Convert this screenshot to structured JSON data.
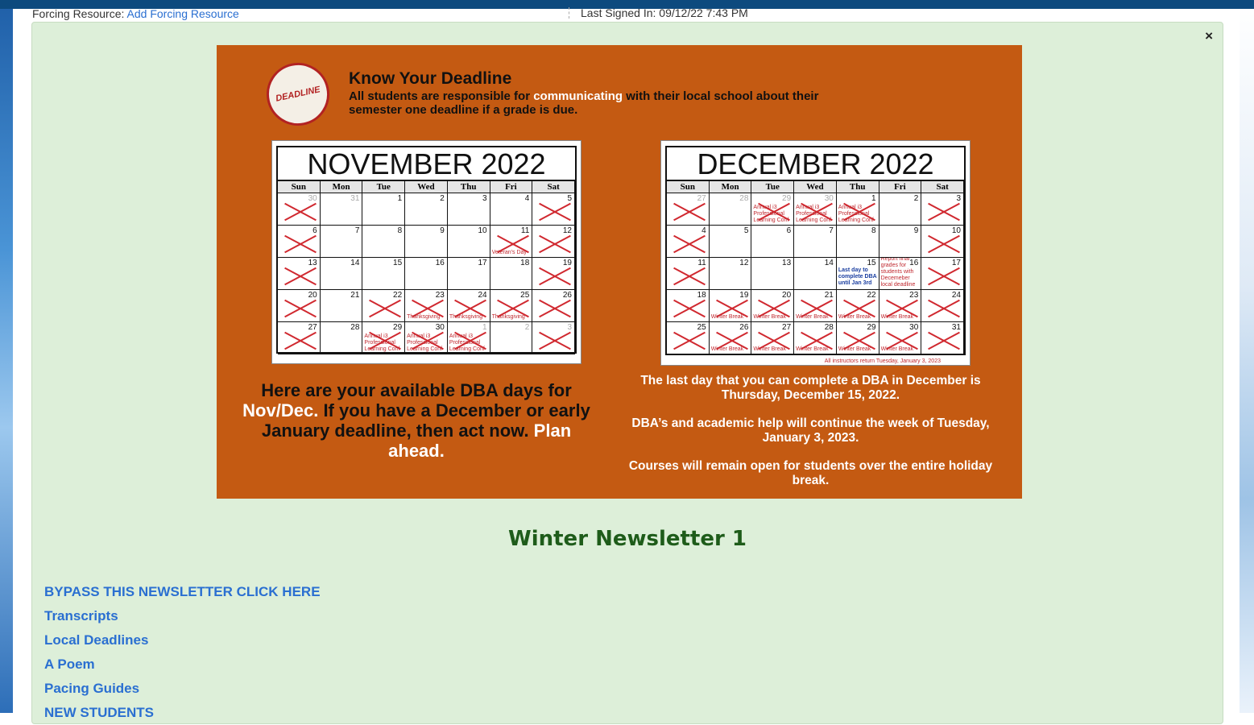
{
  "header": {
    "forcing_label": "Forcing Resource:",
    "forcing_link": "Add Forcing Resource",
    "signed_in": "Last Signed In: 09/12/22 7:43 PM"
  },
  "modal": {
    "close_symbol": "×"
  },
  "banner": {
    "stamp_text": "DEADLINE",
    "title": "Know Your Deadline",
    "subtitle_a": "All students are responsible for ",
    "subtitle_hl": "communicating",
    "subtitle_b": " with their local school about their semester one deadline if a grade is due.",
    "avail_a": "Here are your available DBA days for ",
    "avail_w1": "Nov/Dec.",
    "avail_b": " If you have a December or early January deadline, then act now. ",
    "avail_w2": "Plan ahead.",
    "dec_p1": "The last day that you can complete a DBA in December is Thursday, December 15, 2022.",
    "dec_p2": "DBA’s and academic help will continue the week of Tuesday, January 3, 2023.",
    "dec_p3": "Courses will remain open for students over the entire holiday break."
  },
  "calendars": [
    {
      "title": "NOVEMBER 2022",
      "days": [
        "Sun",
        "Mon",
        "Tue",
        "Wed",
        "Thu",
        "Fri",
        "Sat"
      ],
      "cells": [
        {
          "n": "30",
          "dim": true,
          "x": true
        },
        {
          "n": "31",
          "dim": true
        },
        {
          "n": "1"
        },
        {
          "n": "2"
        },
        {
          "n": "3"
        },
        {
          "n": "4"
        },
        {
          "n": "5",
          "x": true
        },
        {
          "n": "6",
          "x": true
        },
        {
          "n": "7"
        },
        {
          "n": "8"
        },
        {
          "n": "9"
        },
        {
          "n": "10"
        },
        {
          "n": "11",
          "x": true,
          "note": "Veteran's Day"
        },
        {
          "n": "12",
          "x": true
        },
        {
          "n": "13",
          "x": true
        },
        {
          "n": "14"
        },
        {
          "n": "15"
        },
        {
          "n": "16"
        },
        {
          "n": "17"
        },
        {
          "n": "18"
        },
        {
          "n": "19",
          "x": true
        },
        {
          "n": "20",
          "x": true
        },
        {
          "n": "21"
        },
        {
          "n": "22",
          "x": true
        },
        {
          "n": "23",
          "x": true,
          "note": "Thanksgiving"
        },
        {
          "n": "24",
          "x": true,
          "note": "Thanksgiving"
        },
        {
          "n": "25",
          "x": true,
          "note": "Thanksgiving"
        },
        {
          "n": "26",
          "x": true
        },
        {
          "n": "27",
          "x": true
        },
        {
          "n": "28"
        },
        {
          "n": "29",
          "x": true,
          "note": "Annual i3 Professional Learning Conf"
        },
        {
          "n": "30",
          "x": true,
          "note": "Annual i3 Professional Learning Conf"
        },
        {
          "n": "1",
          "dim": true,
          "x": true,
          "note": "Annual i3 Professional Learning Conf"
        },
        {
          "n": "2",
          "dim": true
        },
        {
          "n": "3",
          "dim": true,
          "x": true
        }
      ],
      "footer": ""
    },
    {
      "title": "DECEMBER 2022",
      "days": [
        "Sun",
        "Mon",
        "Tue",
        "Wed",
        "Thu",
        "Fri",
        "Sat"
      ],
      "cells": [
        {
          "n": "27",
          "dim": true,
          "x": true
        },
        {
          "n": "28",
          "dim": true
        },
        {
          "n": "29",
          "dim": true,
          "x": true,
          "note": "Annual i3 Professional Learning Conf"
        },
        {
          "n": "30",
          "dim": true,
          "x": true,
          "note": "Annual i3 Professional Learning Conf"
        },
        {
          "n": "1",
          "x": true,
          "note": "Annual i3 Professional Learning Conf"
        },
        {
          "n": "2"
        },
        {
          "n": "3",
          "x": true
        },
        {
          "n": "4",
          "x": true
        },
        {
          "n": "5"
        },
        {
          "n": "6"
        },
        {
          "n": "7"
        },
        {
          "n": "8"
        },
        {
          "n": "9"
        },
        {
          "n": "10",
          "x": true
        },
        {
          "n": "11",
          "x": true
        },
        {
          "n": "12"
        },
        {
          "n": "13"
        },
        {
          "n": "14"
        },
        {
          "n": "15",
          "note": "Last day to complete DBA until Jan 3rd",
          "blue": true
        },
        {
          "n": "16",
          "note": "Report final grades for students with Decemeber local deadline"
        },
        {
          "n": "17",
          "x": true
        },
        {
          "n": "18",
          "x": true
        },
        {
          "n": "19",
          "x": true,
          "note": "Winter Break"
        },
        {
          "n": "20",
          "x": true,
          "note": "Winter Break"
        },
        {
          "n": "21",
          "x": true,
          "note": "Winter Break"
        },
        {
          "n": "22",
          "x": true,
          "note": "Winter Break"
        },
        {
          "n": "23",
          "x": true,
          "note": "Winter Break"
        },
        {
          "n": "24",
          "x": true
        },
        {
          "n": "25",
          "x": true
        },
        {
          "n": "26",
          "x": true,
          "note": "Winter Break"
        },
        {
          "n": "27",
          "x": true,
          "note": "Winter Break"
        },
        {
          "n": "28",
          "x": true,
          "note": "Winter Break"
        },
        {
          "n": "29",
          "x": true,
          "note": "Winter Break"
        },
        {
          "n": "30",
          "x": true,
          "note": "Winter Break"
        },
        {
          "n": "31",
          "x": true
        }
      ],
      "footer": "All instructors return Tuesday, January 3, 2023"
    }
  ],
  "newsletter": {
    "title": "Winter Newsletter 1",
    "links": [
      "BYPASS THIS NEWSLETTER CLICK HERE",
      "Transcripts",
      "Local Deadlines",
      "A Poem",
      "Pacing Guides",
      "NEW STUDENTS"
    ]
  }
}
